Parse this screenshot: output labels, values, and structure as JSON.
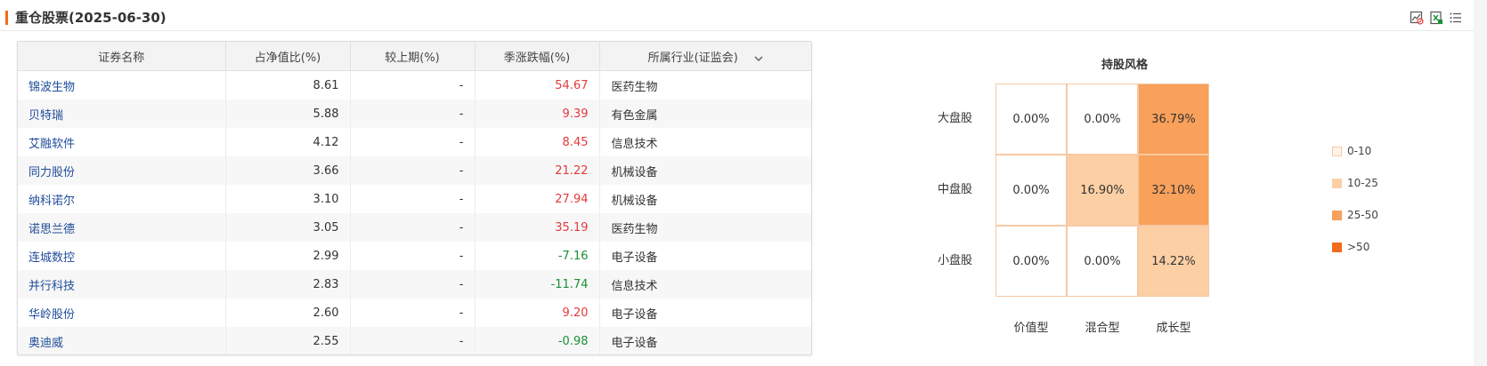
{
  "header": {
    "title": "重仓股票(2025-06-30)"
  },
  "table": {
    "columns": [
      "证券名称",
      "占净值比(%)",
      "较上期(%)",
      "季涨跌幅(%)",
      "所属行业(证监会)"
    ],
    "rows": [
      {
        "name": "锦波生物",
        "pct": "8.61",
        "prev": "-",
        "chg": "54.67",
        "dir": "pos",
        "industry": "医药生物"
      },
      {
        "name": "贝特瑞",
        "pct": "5.88",
        "prev": "-",
        "chg": "9.39",
        "dir": "pos",
        "industry": "有色金属"
      },
      {
        "name": "艾融软件",
        "pct": "4.12",
        "prev": "-",
        "chg": "8.45",
        "dir": "pos",
        "industry": "信息技术"
      },
      {
        "name": "同力股份",
        "pct": "3.66",
        "prev": "-",
        "chg": "21.22",
        "dir": "pos",
        "industry": "机械设备"
      },
      {
        "name": "纳科诺尔",
        "pct": "3.10",
        "prev": "-",
        "chg": "27.94",
        "dir": "pos",
        "industry": "机械设备"
      },
      {
        "name": "诺思兰德",
        "pct": "3.05",
        "prev": "-",
        "chg": "35.19",
        "dir": "pos",
        "industry": "医药生物"
      },
      {
        "name": "连城数控",
        "pct": "2.99",
        "prev": "-",
        "chg": "-7.16",
        "dir": "neg",
        "industry": "电子设备"
      },
      {
        "name": "并行科技",
        "pct": "2.83",
        "prev": "-",
        "chg": "-11.74",
        "dir": "neg",
        "industry": "信息技术"
      },
      {
        "name": "华岭股份",
        "pct": "2.60",
        "prev": "-",
        "chg": "9.20",
        "dir": "pos",
        "industry": "电子设备"
      },
      {
        "name": "奥迪威",
        "pct": "2.55",
        "prev": "-",
        "chg": "-0.98",
        "dir": "neg",
        "industry": "电子设备"
      }
    ]
  },
  "style_box": {
    "title": "持股风格",
    "row_labels": [
      "大盘股",
      "中盘股",
      "小盘股"
    ],
    "col_labels": [
      "价值型",
      "混合型",
      "成长型"
    ],
    "cells": [
      [
        "0.00%",
        "0.00%",
        "36.79%"
      ],
      [
        "0.00%",
        "16.90%",
        "32.10%"
      ],
      [
        "0.00%",
        "0.00%",
        "14.22%"
      ]
    ],
    "levels": [
      [
        0,
        0,
        2
      ],
      [
        0,
        1,
        2
      ],
      [
        0,
        0,
        1
      ]
    ],
    "legend": [
      {
        "label": "0-10",
        "color": "#fff3e8"
      },
      {
        "label": "10-25",
        "color": "#fdcfa5"
      },
      {
        "label": "25-50",
        "color": "#f9a05a"
      },
      {
        "label": ">50",
        "color": "#f26b1d"
      }
    ]
  },
  "colors": {
    "accent": "#f26b1d",
    "link": "#1e4c9a",
    "up": "#e4393c",
    "down": "#1a8f35"
  },
  "icons": [
    "chart-export-icon",
    "excel-export-icon",
    "list-menu-icon"
  ]
}
